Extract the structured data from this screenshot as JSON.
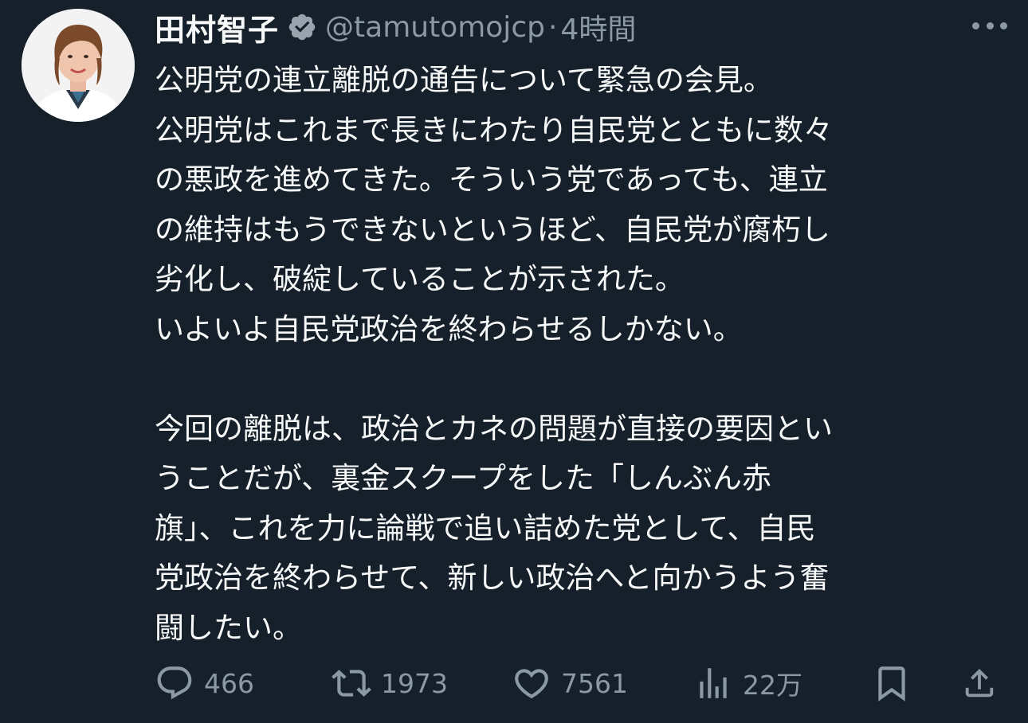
{
  "author": {
    "name": "田村智子",
    "handle": "@tamutomojcp",
    "separator": "·",
    "time": "4時間",
    "verified": true
  },
  "tweet": {
    "lines": [
      "公明党の連立離脱の通告について緊急の会見。",
      "公明党はこれまで長きにわたり自民党とともに数々",
      "の悪政を進めてきた。そういう党であっても、連立",
      "の維持はもうできないというほど、自民党が腐朽し",
      "劣化し、破綻していることが示された。",
      "いよいよ自民党政治を終わらせるしかない。",
      "",
      "今回の離脱は、政治とカネの問題が直接の要因とい",
      "うことだが、裏金スクープをした「しんぶん赤",
      "旗」、これを力に論戦で追い詰めた党として、自民",
      "党政治を終わらせて、新しい政治へと向かうよう奮",
      "闘したい。"
    ]
  },
  "actions": {
    "reply_count": "466",
    "retweet_count": "1973",
    "like_count": "7561",
    "view_count": "22万"
  },
  "icons": {
    "verified": "verified-badge-icon",
    "more": "more-icon",
    "reply": "reply-icon",
    "retweet": "retweet-icon",
    "like": "heart-icon",
    "views": "views-icon",
    "bookmark": "bookmark-icon",
    "share": "share-icon"
  },
  "colors": {
    "background": "#15202b",
    "text": "#f7f9f9",
    "muted": "#8b98a5",
    "verified_badge": "#9aa3ad"
  }
}
